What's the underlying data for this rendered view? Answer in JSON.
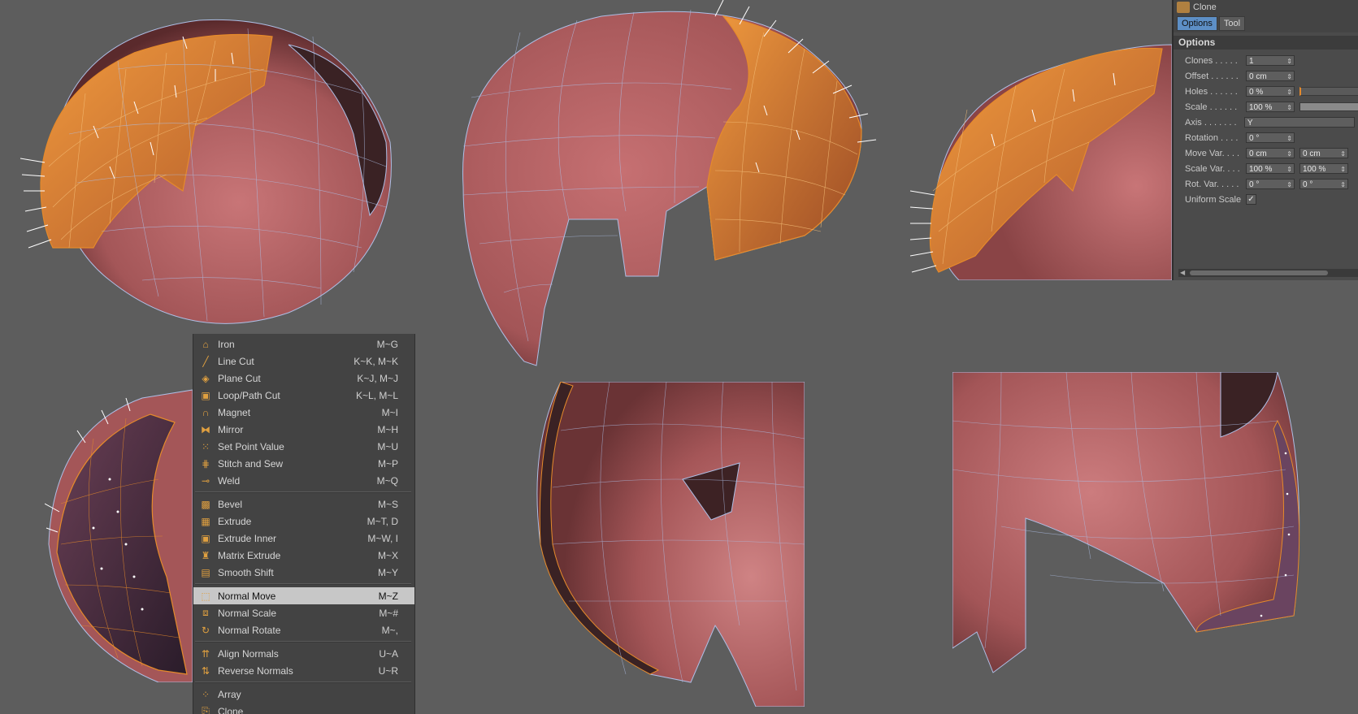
{
  "menu": {
    "groups": [
      [
        {
          "icon": "iron-icon",
          "label": "Iron",
          "shortcut": "M~G"
        },
        {
          "icon": "line-cut-icon",
          "label": "Line Cut",
          "shortcut": "K~K, M~K"
        },
        {
          "icon": "plane-cut-icon",
          "label": "Plane Cut",
          "shortcut": "K~J, M~J"
        },
        {
          "icon": "loop-cut-icon",
          "label": "Loop/Path Cut",
          "shortcut": "K~L, M~L"
        },
        {
          "icon": "magnet-icon",
          "label": "Magnet",
          "shortcut": "M~I"
        },
        {
          "icon": "mirror-icon",
          "label": "Mirror",
          "shortcut": "M~H"
        },
        {
          "icon": "set-point-value-icon",
          "label": "Set Point Value",
          "shortcut": "M~U"
        },
        {
          "icon": "stitch-sew-icon",
          "label": "Stitch and Sew",
          "shortcut": "M~P"
        },
        {
          "icon": "weld-icon",
          "label": "Weld",
          "shortcut": "M~Q"
        }
      ],
      [
        {
          "icon": "bevel-icon",
          "label": "Bevel",
          "shortcut": "M~S"
        },
        {
          "icon": "extrude-icon",
          "label": "Extrude",
          "shortcut": "M~T, D"
        },
        {
          "icon": "extrude-inner-icon",
          "label": "Extrude Inner",
          "shortcut": "M~W, I"
        },
        {
          "icon": "matrix-extrude-icon",
          "label": "Matrix Extrude",
          "shortcut": "M~X"
        },
        {
          "icon": "smooth-shift-icon",
          "label": "Smooth Shift",
          "shortcut": "M~Y"
        }
      ],
      [
        {
          "icon": "normal-move-icon",
          "label": "Normal Move",
          "shortcut": "M~Z",
          "highlight": true
        },
        {
          "icon": "normal-scale-icon",
          "label": "Normal Scale",
          "shortcut": "M~#"
        },
        {
          "icon": "normal-rotate-icon",
          "label": "Normal Rotate",
          "shortcut": "M~,"
        }
      ],
      [
        {
          "icon": "align-normals-icon",
          "label": "Align Normals",
          "shortcut": "U~A"
        },
        {
          "icon": "reverse-normals-icon",
          "label": "Reverse Normals",
          "shortcut": "U~R"
        }
      ],
      [
        {
          "icon": "array-icon",
          "label": "Array",
          "shortcut": ""
        },
        {
          "icon": "clone-icon",
          "label": "Clone",
          "shortcut": ""
        }
      ]
    ]
  },
  "panel": {
    "title": "Clone",
    "tabs": [
      "Options",
      "Tool"
    ],
    "section": "Options",
    "rows": {
      "clones": {
        "label": "Clones . . . . .",
        "v1": "1"
      },
      "offset": {
        "label": "Offset . . . . . .",
        "v1": "0 cm"
      },
      "holes": {
        "label": "Holes . . . . . .",
        "v1": "0 %"
      },
      "scale": {
        "label": "Scale . . . . . .",
        "v1": "100 %"
      },
      "axis": {
        "label": "Axis . . . . . . .",
        "v1": "Y"
      },
      "rotation": {
        "label": "Rotation . . . .",
        "v1": "0 °"
      },
      "movevar": {
        "label": "Move Var. . . .",
        "v1": "0 cm",
        "v2": "0 cm"
      },
      "scalevar": {
        "label": "Scale Var. . . .",
        "v1": "100 %",
        "v2": "100 %"
      },
      "rotvar": {
        "label": "Rot. Var. . . . .",
        "v1": "0 °",
        "v2": "0 °"
      },
      "uniform": {
        "label": "Uniform Scale",
        "v1": "✓"
      }
    }
  },
  "colors": {
    "mesh": "#b86466",
    "selection": "#e58a2b",
    "wire": "#aebfe6",
    "background": "#5d5d5d"
  }
}
